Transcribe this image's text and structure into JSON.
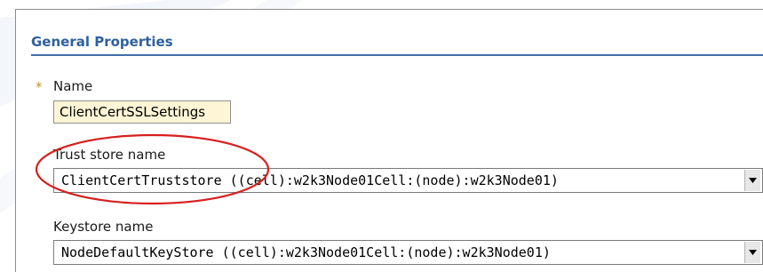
{
  "general_properties": {
    "title": "General Properties"
  },
  "fields": {
    "name": {
      "required_marker": "*",
      "label": "Name",
      "value": "ClientCertSSLSettings"
    },
    "trust_store": {
      "label": "Trust store name",
      "selected": "ClientCertTruststore ((cell):w2k3Node01Cell:(node):w2k3Node01)"
    },
    "keystore": {
      "label": "Keystore name",
      "selected": "NodeDefaultKeyStore ((cell):w2k3Node01Cell:(node):w2k3Node01)"
    }
  },
  "icons": {
    "dropdown_arrow": "chevron-down-icon",
    "required": "asterisk-icon"
  },
  "colors": {
    "section_title": "#2f5f9e",
    "section_rule": "#3f6ea8",
    "required_field_bg": "#fdf5d6",
    "annotation_circle": "#d81e1e",
    "required_star": "#b89a2a"
  }
}
